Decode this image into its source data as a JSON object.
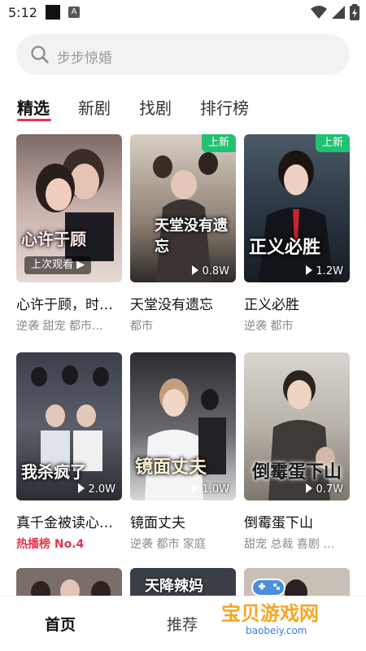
{
  "status_bar": {
    "time": "5:12",
    "notif_icon": "A"
  },
  "search": {
    "placeholder": "步步惊婚"
  },
  "tabs": [
    {
      "label": "精选",
      "active": true
    },
    {
      "label": "新剧",
      "active": false
    },
    {
      "label": "找剧",
      "active": false
    },
    {
      "label": "排行榜",
      "active": false
    }
  ],
  "cards": [
    {
      "title": "心许于顾，时…",
      "sub": "逆袭 甜宠 都市…",
      "poster_text": "心许于顾",
      "last_watched": "上次观看 ▶",
      "views": "",
      "badge": ""
    },
    {
      "title": "天堂没有遗忘",
      "sub": "都市",
      "poster_text": "天堂没有遗忘",
      "last_watched": "",
      "views": "0.8W",
      "badge": "上新"
    },
    {
      "title": "正义必胜",
      "sub": "逆袭 都市",
      "poster_text": "正义必胜",
      "last_watched": "",
      "views": "1.2W",
      "badge": "上新"
    },
    {
      "title": "真千金被读心…",
      "sub": "热播榜 No.4",
      "poster_text": "我杀疯了",
      "last_watched": "",
      "views": "2.0W",
      "badge": ""
    },
    {
      "title": "镜面丈夫",
      "sub": "逆袭 都市 家庭",
      "poster_text": "镜面丈夫",
      "last_watched": "",
      "views": "1.0W",
      "badge": ""
    },
    {
      "title": "倒霉蛋下山",
      "sub": "甜宠 总裁 喜剧 …",
      "poster_text": "倒霉蛋下山",
      "last_watched": "",
      "views": "0.7W",
      "badge": ""
    }
  ],
  "peek_cards": [
    {
      "poster_text": ""
    },
    {
      "poster_text": "天降辣妈"
    },
    {
      "poster_text": ""
    }
  ],
  "bottom_nav": [
    {
      "label": "首页",
      "active": true
    },
    {
      "label": "推荐",
      "active": false
    }
  ],
  "watermark": {
    "text": "宝贝游戏网",
    "url": "baobeiy.com"
  },
  "colors": {
    "accent": "#e8334f",
    "badge_new": "#21c271",
    "search_bg": "#f2f2f2"
  }
}
